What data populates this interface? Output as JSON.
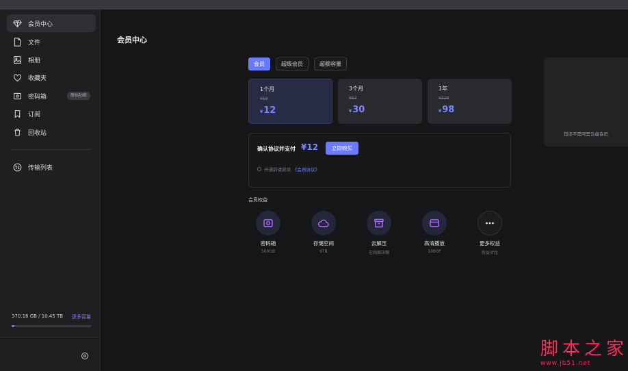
{
  "sidebar": {
    "items": [
      {
        "label": "会员中心",
        "icon": "diamond-icon"
      },
      {
        "label": "文件",
        "icon": "file-icon"
      },
      {
        "label": "相册",
        "icon": "image-icon"
      },
      {
        "label": "收藏夹",
        "icon": "heart-icon"
      },
      {
        "label": "密码箱",
        "icon": "safe-icon",
        "badge": "原始功能"
      },
      {
        "label": "订阅",
        "icon": "bookmark-icon"
      },
      {
        "label": "回收站",
        "icon": "trash-icon"
      },
      {
        "label": "传输列表",
        "icon": "transfer-icon"
      }
    ],
    "storage": {
      "used_text": "370.16 GB / 10.45 TB",
      "link": "更多容量",
      "used_fraction": 0.035
    }
  },
  "main": {
    "title": "会员中心",
    "tabs": [
      "会员",
      "超级会员",
      "超额容量"
    ],
    "plans": [
      {
        "name": "1个月",
        "original": "¥19",
        "currency": "¥",
        "price": "12"
      },
      {
        "name": "3个月",
        "original": "¥57",
        "currency": "¥",
        "price": "30"
      },
      {
        "name": "1年",
        "original": "¥228",
        "currency": "¥",
        "price": "98"
      }
    ],
    "payment": {
      "label": "确认协议并支付",
      "amount": "¥12",
      "button": "立即购买",
      "agree_text": "开通前请阅读",
      "agree_link": "《会员协议》"
    },
    "perks_title": "会员权益",
    "perks": [
      {
        "name": "密码箱",
        "sub": "500GB",
        "icon": "safe-icon"
      },
      {
        "name": "存储空间",
        "sub": "6TB",
        "icon": "cloud-icon"
      },
      {
        "name": "云解压",
        "sub": "在线解压缩",
        "icon": "archive-icon"
      },
      {
        "name": "高清播放",
        "sub": "1080P",
        "icon": "video-icon"
      },
      {
        "name": "更多权益",
        "sub": "权益对比",
        "icon": "more-icon"
      }
    ],
    "right_card_text": "您还不是阿里云盘会员"
  },
  "watermark": {
    "big": "脚本之家",
    "small": "www.jb51.net"
  },
  "colors": {
    "accent": "#6b7bff",
    "price": "#7b86ff",
    "sidebar_bg": "#1f1f22",
    "page_bg": "#161618"
  }
}
